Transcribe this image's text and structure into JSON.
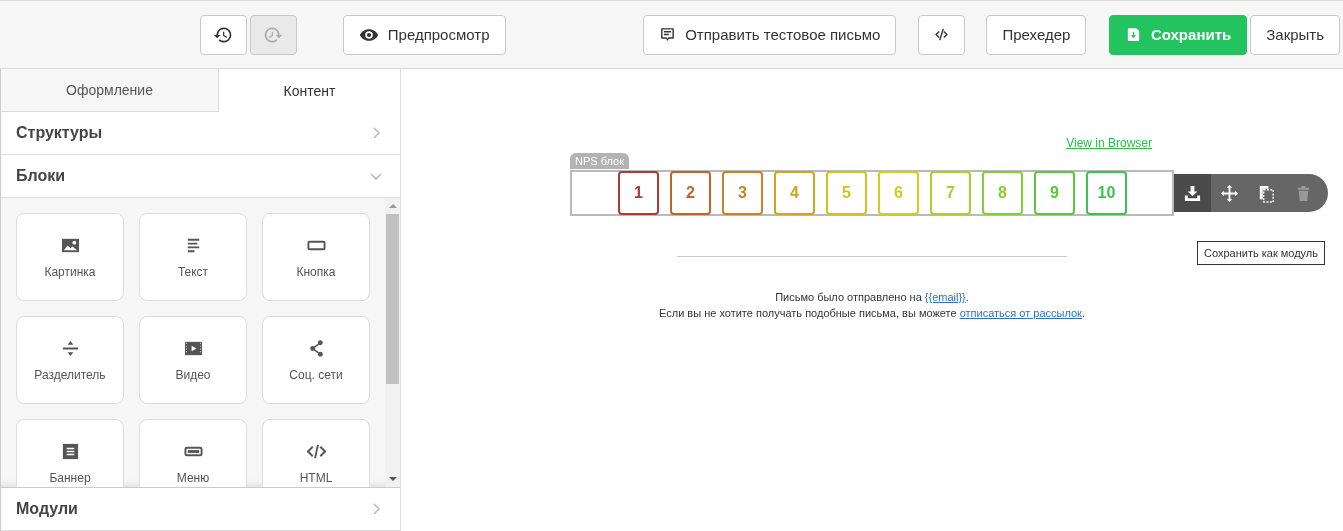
{
  "toolbar": {
    "buttons": [
      {
        "kind": "undo",
        "disabled": false
      },
      {
        "kind": "redo",
        "disabled": true
      },
      {
        "kind": "preview",
        "label": "Предпросмотр",
        "disabled": false
      },
      {
        "kind": "test",
        "label": "Отправить тестовое письмо",
        "disabled": false
      },
      {
        "kind": "code",
        "disabled": false
      },
      {
        "kind": "plain",
        "label": "Прехедер",
        "disabled": false
      },
      {
        "kind": "save",
        "label": "Сохранить",
        "disabled": false
      },
      {
        "kind": "plain",
        "label": "Закрыть",
        "disabled": false
      }
    ]
  },
  "tabs": [
    {
      "label": "Оформление",
      "selected": false
    },
    {
      "label": "Контент",
      "selected": true
    }
  ],
  "sections": [
    {
      "title": "Структуры",
      "expanded": false
    },
    {
      "title": "Блоки",
      "expanded": true,
      "blocks": [
        {
          "kind": "image",
          "label": "Картинка"
        },
        {
          "kind": "text",
          "label": "Текст"
        },
        {
          "kind": "button",
          "label": "Кнопка"
        },
        {
          "kind": "divider",
          "label": "Разделитель"
        },
        {
          "kind": "video",
          "label": "Видео"
        },
        {
          "kind": "social",
          "label": "Соц. сети"
        },
        {
          "kind": "banner",
          "label": "Баннер"
        },
        {
          "kind": "menu",
          "label": "Меню"
        },
        {
          "kind": "html",
          "label": "HTML"
        }
      ]
    },
    {
      "title": "Модули",
      "expanded": false
    }
  ],
  "canvas": {
    "view_in_browser": "View in Browser",
    "nps_block": {
      "label": "NPS блок",
      "scores": [
        {
          "label": "1",
          "color": "#b03a3a"
        },
        {
          "label": "2",
          "color": "#c0652b"
        },
        {
          "label": "3",
          "color": "#c9822a"
        },
        {
          "label": "4",
          "color": "#d3a21f"
        },
        {
          "label": "5",
          "color": "#d2c31c"
        },
        {
          "label": "6",
          "color": "#c8d21c"
        },
        {
          "label": "7",
          "color": "#a9d12b"
        },
        {
          "label": "8",
          "color": "#86cc35"
        },
        {
          "label": "9",
          "color": "#5cc63d"
        },
        {
          "label": "10",
          "color": "#3cc251"
        }
      ],
      "actions": [
        {
          "kind": "save_module",
          "selected": true
        },
        {
          "kind": "move",
          "selected": false
        },
        {
          "kind": "copy",
          "selected": false
        },
        {
          "kind": "delete",
          "selected": false
        }
      ],
      "tooltip": "Сохранить как модуль"
    },
    "footer": [
      {
        "before": "Письмо было отправлено на ",
        "link": "{{email}}",
        "after": "."
      },
      {
        "before": "Если вы не хотите получать подобные письма, вы можете ",
        "link": "отписаться от рассылок",
        "after": "."
      }
    ]
  }
}
